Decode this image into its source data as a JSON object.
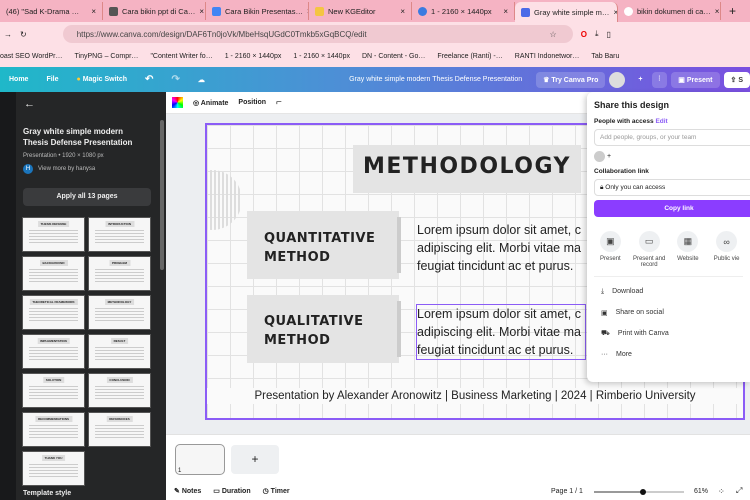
{
  "browser": {
    "tabs": [
      {
        "label": "(46) \"Sad K-Drama …"
      },
      {
        "label": "Cara bikin ppt di Ca…"
      },
      {
        "label": "Cara Bikin Presentas…"
      },
      {
        "label": "New KGEditor"
      },
      {
        "label": "1 - 2160 × 1440px"
      },
      {
        "label": "Gray white simple m…",
        "active": true
      },
      {
        "label": "bikin dokumen di ca…"
      }
    ],
    "url": "https://www.canva.com/design/DAF6Tn0joVk/MbeHsqUGdC0Tmkb5xGqBCQ/edit",
    "bookmarks": [
      "oast SEO WordPr…",
      "TinyPNG – Compr…",
      "\"Content Writer fo…",
      "1 - 2160 × 1440px",
      "1 - 2160 × 1440px",
      "DN - Content - Go…",
      "Freelance (Ranti) -…",
      "RANTI Indonetwor…",
      "Tab Baru"
    ]
  },
  "header": {
    "home": "Home",
    "file": "File",
    "magic": "Magic Switch",
    "title": "Gray white simple modern Thesis Defense Presentation",
    "try_pro": "Try Canva Pro",
    "present": "Present",
    "share": "S"
  },
  "panel": {
    "title": "Gray white simple modern Thesis Defense Presentation",
    "meta": "Presentation • 1920 × 1080 px",
    "author_initial": "H",
    "author": "View more by hanysa",
    "apply": "Apply all 13 pages",
    "template_style": "Template style",
    "pages": [
      "THESIS DEFENSE",
      "INTRODUCTION",
      "BACKGROUND",
      "PROBLEM",
      "THEORETICAL FRAMEWORK",
      "METHODOLOGY",
      "IMPLEMENTATION",
      "RESULT",
      "SOLUTION",
      "CONCLUSION",
      "RECOMMENDATIONS",
      "REFERENCES",
      "THANK YOU"
    ]
  },
  "toolbar": {
    "animate": "Animate",
    "position": "Position"
  },
  "slide": {
    "title": "METHODOLOGY",
    "m1": "QUANTITATIVE METHOD",
    "m2": "QUALITATIVE METHOD",
    "t1": [
      "Lorem ipsum dolor sit amet, c",
      "adipiscing elit. Morbi vitae ma",
      "feugiat tincidunt ac et purus."
    ],
    "t2": [
      "Lorem ipsum dolor sit amet, c",
      "adipiscing elit. Morbi vitae ma",
      "feugiat tincidunt ac et purus."
    ],
    "footer": "Presentation by Alexander Aronowitz | Business Marketing | 2024 | Rimberio University"
  },
  "share": {
    "title": "Share this design",
    "people": "People with access",
    "edit": "Edit",
    "placeholder": "Add people, groups, or your team",
    "collab": "Collaboration link",
    "access": "Only you can access",
    "copy": "Copy link",
    "options": [
      "Present",
      "Present and record",
      "Website",
      "Public vie"
    ],
    "actions": [
      "Download",
      "Share on social",
      "Print with Canva",
      "More"
    ]
  },
  "bottom": {
    "page_num": "1",
    "notes": "Notes",
    "duration": "Duration",
    "timer": "Timer",
    "page": "Page 1 / 1",
    "zoom": "61%",
    "zoom_value": 61
  },
  "colors": {
    "accent": "#8b5cf6"
  }
}
